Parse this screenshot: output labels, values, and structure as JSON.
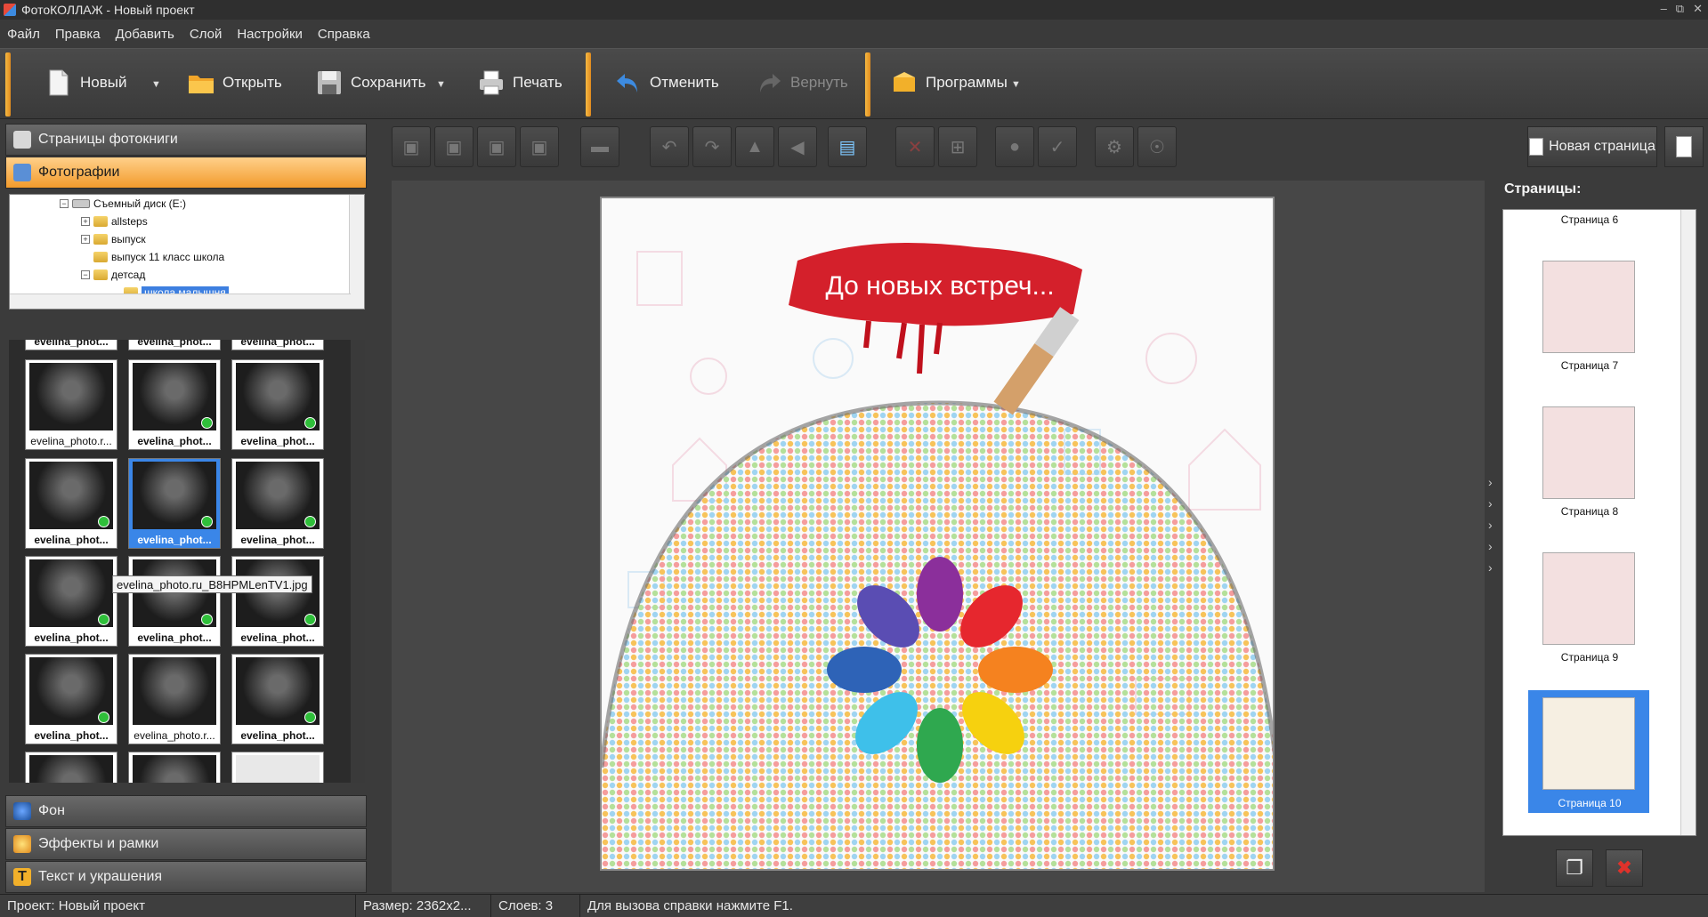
{
  "window": {
    "title": "ФотоКОЛЛАЖ - Новый проект"
  },
  "menu": [
    "Файл",
    "Правка",
    "Добавить",
    "Слой",
    "Настройки",
    "Справка"
  ],
  "toolbar": {
    "new": "Новый",
    "open": "Открыть",
    "save": "Сохранить",
    "print": "Печать",
    "undo": "Отменить",
    "redo": "Вернуть",
    "programs": "Программы"
  },
  "left_panel": {
    "sections": {
      "pages": "Страницы фотокниги",
      "photos": "Фотографии",
      "background": "Фон",
      "effects": "Эффекты и рамки",
      "text": "Текст и украшения"
    },
    "tree": {
      "drive": "Съемный диск (E:)",
      "folders": [
        "allsteps",
        "выпуск",
        "выпуск 11 класс школа",
        "детсад"
      ],
      "selected": "школа малышня"
    },
    "thumbnails": {
      "top_row": [
        "evelina_phot...",
        "evelina_phot...",
        "evelina_phot..."
      ],
      "rows": [
        [
          "evelina_photo.r...",
          "evelina_phot...",
          "evelina_phot..."
        ],
        [
          "evelina_phot...",
          "evelina_phot...",
          "evelina_phot..."
        ],
        [
          "evelina_phot...",
          "evelina_phot...",
          "evelina_phot..."
        ],
        [
          "evelina_phot...",
          "evelina_photo.r...",
          "evelina_phot..."
        ]
      ],
      "tooltip": "evelina_photo.ru_B8HPMLenTV1.jpg"
    }
  },
  "canvas": {
    "banner_text": "До новых встреч..."
  },
  "right_panel": {
    "new_page": "Новая страница",
    "pages_label": "Страницы:",
    "pages": [
      "Страница 6",
      "Страница 7",
      "Страница 8",
      "Страница 9",
      "Страница 10"
    ],
    "selected_page": "Страница 10"
  },
  "status": {
    "project": "Проект:  Новый проект",
    "size": "Размер:  2362x2...",
    "layers": "Слоев:  3",
    "help": "Для вызова справки нажмите F1."
  }
}
